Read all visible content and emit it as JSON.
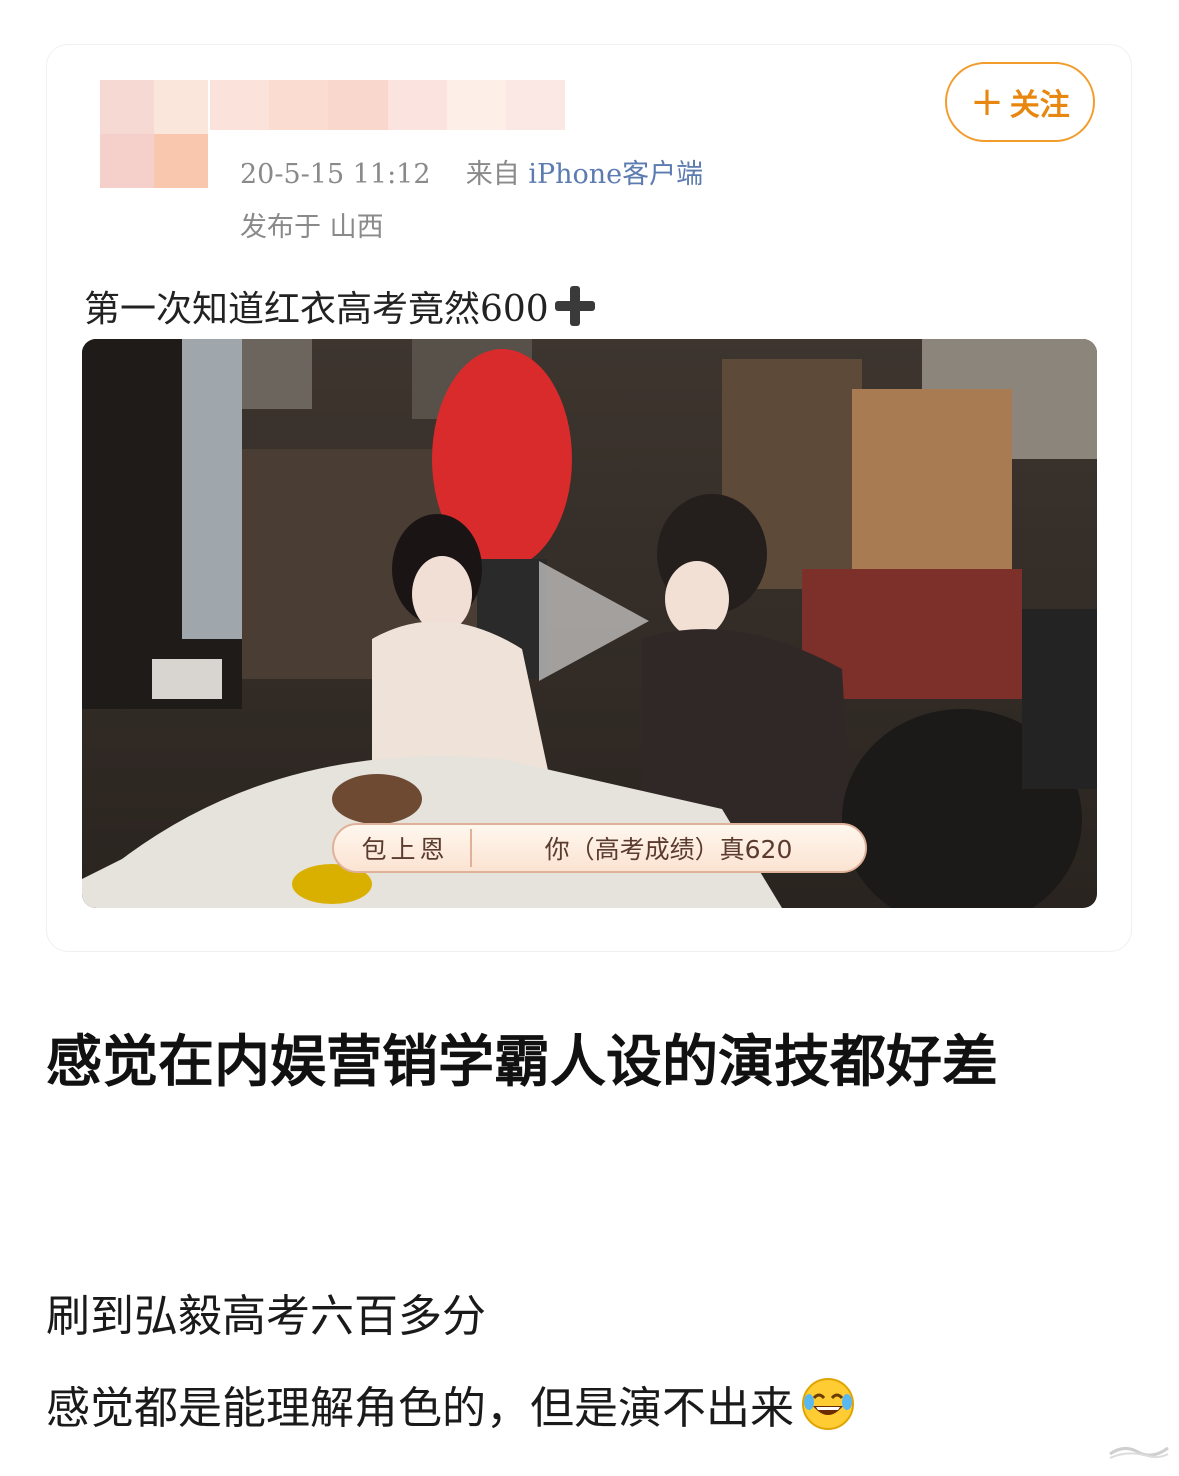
{
  "post_card": {
    "timestamp": "20-5-15 11:12",
    "source_prefix": "来自",
    "source_device": "iPhone客户端",
    "location": "发布于 山西",
    "follow_label": "关注",
    "follow_icon": "plus-icon",
    "text": "第一次知道红衣高考竟然600",
    "text_emoji": "heavy-plus-emoji",
    "video": {
      "subtitle_speaker": "包上恩",
      "subtitle_line": "你（高考成绩）真620",
      "play_icon": "play-icon"
    }
  },
  "headline": "感觉在内娱营销学霸人设的演技都好差",
  "body": {
    "line1": "刷到弘毅高考六百多分",
    "line2": "感觉都是能理解角色的，但是演不出来",
    "line2_emoji": "tears-of-joy-emoji"
  },
  "colors": {
    "follow_accent": "#f29c2b",
    "source_link": "#5c7bb0",
    "meta_gray": "#8a8a8a"
  }
}
